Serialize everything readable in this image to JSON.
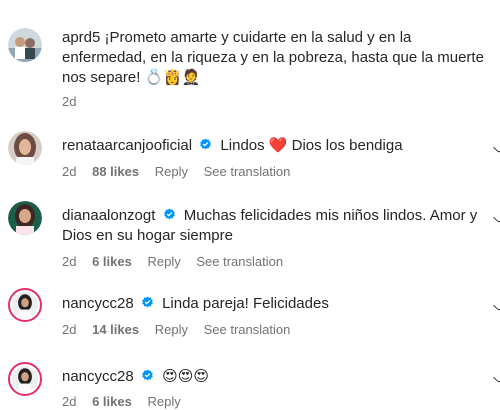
{
  "comments": [
    {
      "username": "aprd5",
      "text": "¡Prometo amarte y cuidarte en la salud y en la enfermedad, en la riqueza y en la pobreza, hasta que la muerte nos separe! 💍👸🤵",
      "time": "2d"
    },
    {
      "username": "renataarcanjooficial",
      "text": "Lindos ❤️ Dios los bendiga",
      "time": "2d",
      "likes": "88 likes",
      "reply": "Reply",
      "translation": "See translation"
    },
    {
      "username": "dianaalonzogt",
      "text": "Muchas felicidades mis niños lindos. Amor y Dios en su hogar siempre",
      "time": "2d",
      "likes": "6 likes",
      "reply": "Reply",
      "translation": "See translation"
    },
    {
      "username": "nancycc28",
      "text": "Linda pareja! Felicidades",
      "time": "2d",
      "likes": "14 likes",
      "reply": "Reply",
      "translation": "See translation"
    },
    {
      "username": "nancycc28",
      "text": "😍😍😍",
      "time": "2d",
      "likes": "6 likes",
      "reply": "Reply"
    }
  ],
  "colors": {
    "verified": "#0095f6",
    "meta": "#737373",
    "story_ring": "#e1306c"
  }
}
